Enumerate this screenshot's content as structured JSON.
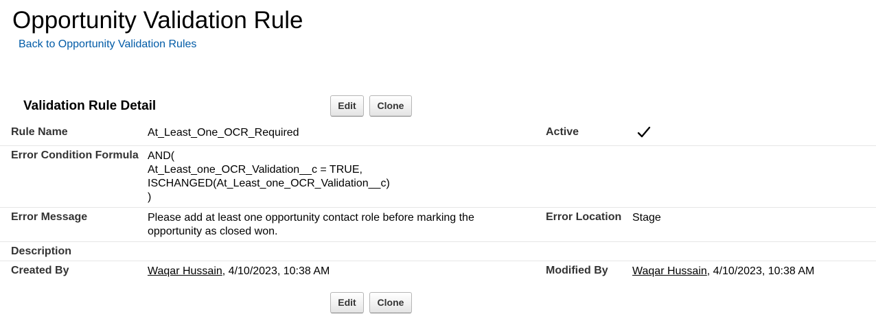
{
  "page": {
    "title": "Opportunity Validation Rule",
    "back_link": "Back to Opportunity Validation Rules"
  },
  "section": {
    "title": "Validation Rule Detail",
    "edit_label": "Edit",
    "clone_label": "Clone"
  },
  "fields": {
    "rule_name": {
      "label": "Rule Name",
      "value": "At_Least_One_OCR_Required"
    },
    "active": {
      "label": "Active",
      "checked": true,
      "icon": "checkmark-icon"
    },
    "formula": {
      "label": "Error Condition Formula",
      "lines": [
        "AND(",
        "At_Least_one_OCR_Validation__c = TRUE,",
        "ISCHANGED(At_Least_one_OCR_Validation__c)",
        ")"
      ]
    },
    "error_message": {
      "label": "Error Message",
      "lines": [
        "Please add at least one opportunity contact role before marking the",
        "opportunity as closed won."
      ]
    },
    "error_location": {
      "label": "Error Location",
      "value": "Stage"
    },
    "description": {
      "label": "Description",
      "value": ""
    },
    "created_by": {
      "label": "Created By",
      "user": "Waqar Hussain",
      "date": ", 4/10/2023, 10:38 AM"
    },
    "modified_by": {
      "label": "Modified By",
      "user": "Waqar Hussain",
      "date": ", 4/10/2023, 10:38 AM"
    }
  },
  "colors": {
    "link": "#015ba7",
    "label": "#333333",
    "divider": "#e6e6e6"
  }
}
